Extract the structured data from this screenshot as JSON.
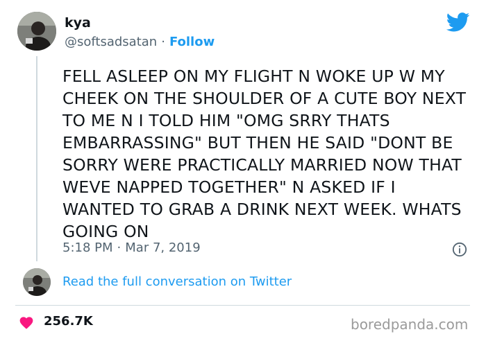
{
  "author": {
    "display_name": "kya",
    "handle": "@softsadsatan",
    "separator": "·",
    "follow_label": "Follow"
  },
  "tweet": {
    "text": "FELL ASLEEP ON MY FLIGHT N WOKE UP W MY CHEEK ON THE SHOULDER OF A CUTE BOY NEXT TO ME N I TOLD HIM \"OMG SRRY THATS EMBARRASSING\" BUT THEN HE SAID \"DONT BE SORRY WERE PRACTICALLY MARRIED NOW THAT WEVE NAPPED TOGETHER\" N ASKED IF I WANTED TO GRAB A DRINK NEXT WEEK. WHATS GOING ON",
    "time": "5:18 PM",
    "separator": "·",
    "date": "Mar 7, 2019"
  },
  "conversation": {
    "link_label": "Read the full conversation on Twitter"
  },
  "stats": {
    "likes": "256.7K"
  },
  "watermark": "boredpanda.com",
  "icons": {
    "brand": "twitter-bird-icon",
    "info": "info-icon",
    "like": "heart-icon"
  },
  "colors": {
    "accent": "#1d9bf0",
    "heart": "#f91880",
    "secondary_text": "#536471",
    "primary_text": "#0f1419"
  }
}
